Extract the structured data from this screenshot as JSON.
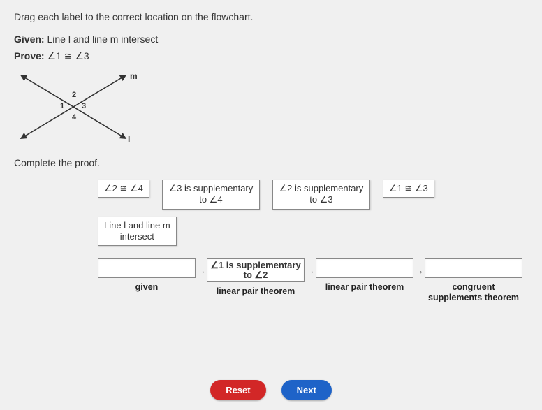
{
  "instructions": "Drag each label to the correct location on the flowchart.",
  "given": {
    "prefix": "Given:",
    "text": " Line l and line m intersect"
  },
  "prove": {
    "prefix": "Prove:",
    "text": " ∠1 ≅ ∠3"
  },
  "diagram": {
    "line_m_label": "m",
    "line_l_label": "l",
    "angle_labels": {
      "top": "2",
      "left": "1",
      "right": "3",
      "bottom": "4"
    }
  },
  "complete_text": "Complete the proof.",
  "bank": {
    "row1": [
      "∠2 ≅ ∠4",
      "∠3 is supplementary\nto ∠4",
      "∠2 is supplementary\nto ∠3",
      "∠1 ≅ ∠3"
    ],
    "row2": [
      "Line l and line m\nintersect"
    ]
  },
  "flow": {
    "slots": [
      {
        "content": "",
        "caption": "given"
      },
      {
        "content": "∠1 is supplementary\nto ∠2",
        "caption": "linear pair theorem"
      },
      {
        "content": "",
        "caption": "linear pair theorem"
      },
      {
        "content": "",
        "caption": "congruent\nsupplements theorem"
      }
    ]
  },
  "buttons": {
    "reset": "Reset",
    "next": "Next"
  }
}
